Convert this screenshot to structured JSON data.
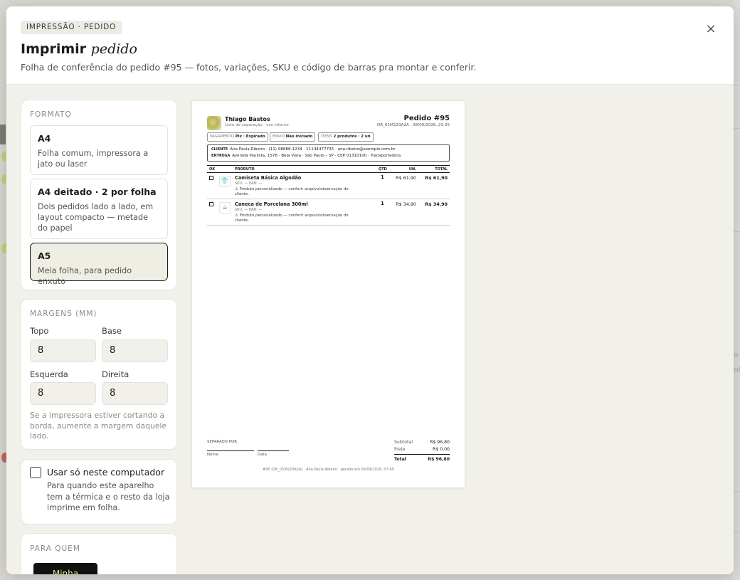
{
  "background": {
    "text_right_1": "o",
    "text_right_2": "ol,"
  },
  "modal": {
    "eyebrow": "IMPRESSÃO · PEDIDO",
    "title_main": "Imprimir",
    "title_em": "pedido",
    "subtitle": "Folha de conferência do pedido #95 — fotos, variações, SKU e código de barras pra montar e conferir.",
    "close_icon": "×"
  },
  "format": {
    "label": "FORMATO",
    "options": [
      {
        "title": "A4",
        "desc": "Folha comum, impressora a jato ou laser",
        "selected": false
      },
      {
        "title": "A4 deitado · 2 por folha",
        "desc": "Dois pedidos lado a lado, em layout compacto — metade do papel",
        "selected": false
      },
      {
        "title": "A5",
        "desc": "Meia folha, para pedido enxuto",
        "selected": true
      }
    ]
  },
  "margins": {
    "label": "MARGENS (MM)",
    "top_label": "Topo",
    "top_value": "8",
    "bottom_label": "Base",
    "bottom_value": "8",
    "left_label": "Esquerda",
    "left_value": "8",
    "right_label": "Direita",
    "right_value": "8",
    "hint": "Se a impressora estiver cortando a borda, aumente a margem daquele lado."
  },
  "local": {
    "label": "Usar só neste computador",
    "desc": "Para quando este aparelho tem a térmica e o resto da loja imprime em folha.",
    "checked": false
  },
  "audience": {
    "label": "PARA QUEM",
    "button": "Minha"
  },
  "sheet": {
    "store_name": "Thiago Bastos",
    "store_sub": "Lista de separação · uso interno",
    "order_title": "Pedido #95",
    "order_sub": "OR_01M220A2A · 08/09/2026, 23:35",
    "tags": [
      {
        "label": "PAGAMENTO",
        "value": "Pix · Expirado"
      },
      {
        "label": "ENVIO",
        "value": "Não iniciado"
      },
      {
        "label": "ITENS",
        "value": "2 produtos · 2 un"
      }
    ],
    "customer_label": "CLIENTE",
    "customer": "Ana Paula Ribeiro · (11) 98888-1234 · 11144477735 · ana.ribeiro@exemplo.com.br",
    "delivery_label": "ENTREGA",
    "delivery": "Avenida Paulista, 1578 · Bela Vista · São Paulo – SP · CEP 01310100 · Transportadora",
    "columns": {
      "ok": "OK",
      "product": "PRODUTO",
      "qty": "QTD",
      "unit": "UN.",
      "total": "TOTAL"
    },
    "items": [
      {
        "name": "Camiseta Básica Algodão",
        "sku": "SKU: —   EAN: —",
        "note": "⚠ Produto personalizado — conferir arquivo/observação do cliente.",
        "qty": "1",
        "unit": "R$ 61,90",
        "total": "R$ 61,90",
        "thumb": "👕"
      },
      {
        "name": "Caneca de Porcelana 300ml",
        "sku": "SKU: —   EAN: —",
        "note": "⚠ Produto personalizado — conferir arquivo/observação do cliente.",
        "qty": "1",
        "unit": "R$ 34,90",
        "total": "R$ 34,90",
        "thumb": "☕"
      }
    ],
    "separated_by": "SEPARADO POR",
    "sig_name": "Nome",
    "sig_date": "Data",
    "subtotal_label": "Subtotal",
    "subtotal": "R$ 96,80",
    "shipping_label": "Frete",
    "shipping": "R$ 0,00",
    "total_label": "Total",
    "total": "R$ 96,80",
    "footer": "#95 (OR_01M220A2A) · Ana Paula Ribeiro · gerado em 09/09/2026, 07:45"
  }
}
